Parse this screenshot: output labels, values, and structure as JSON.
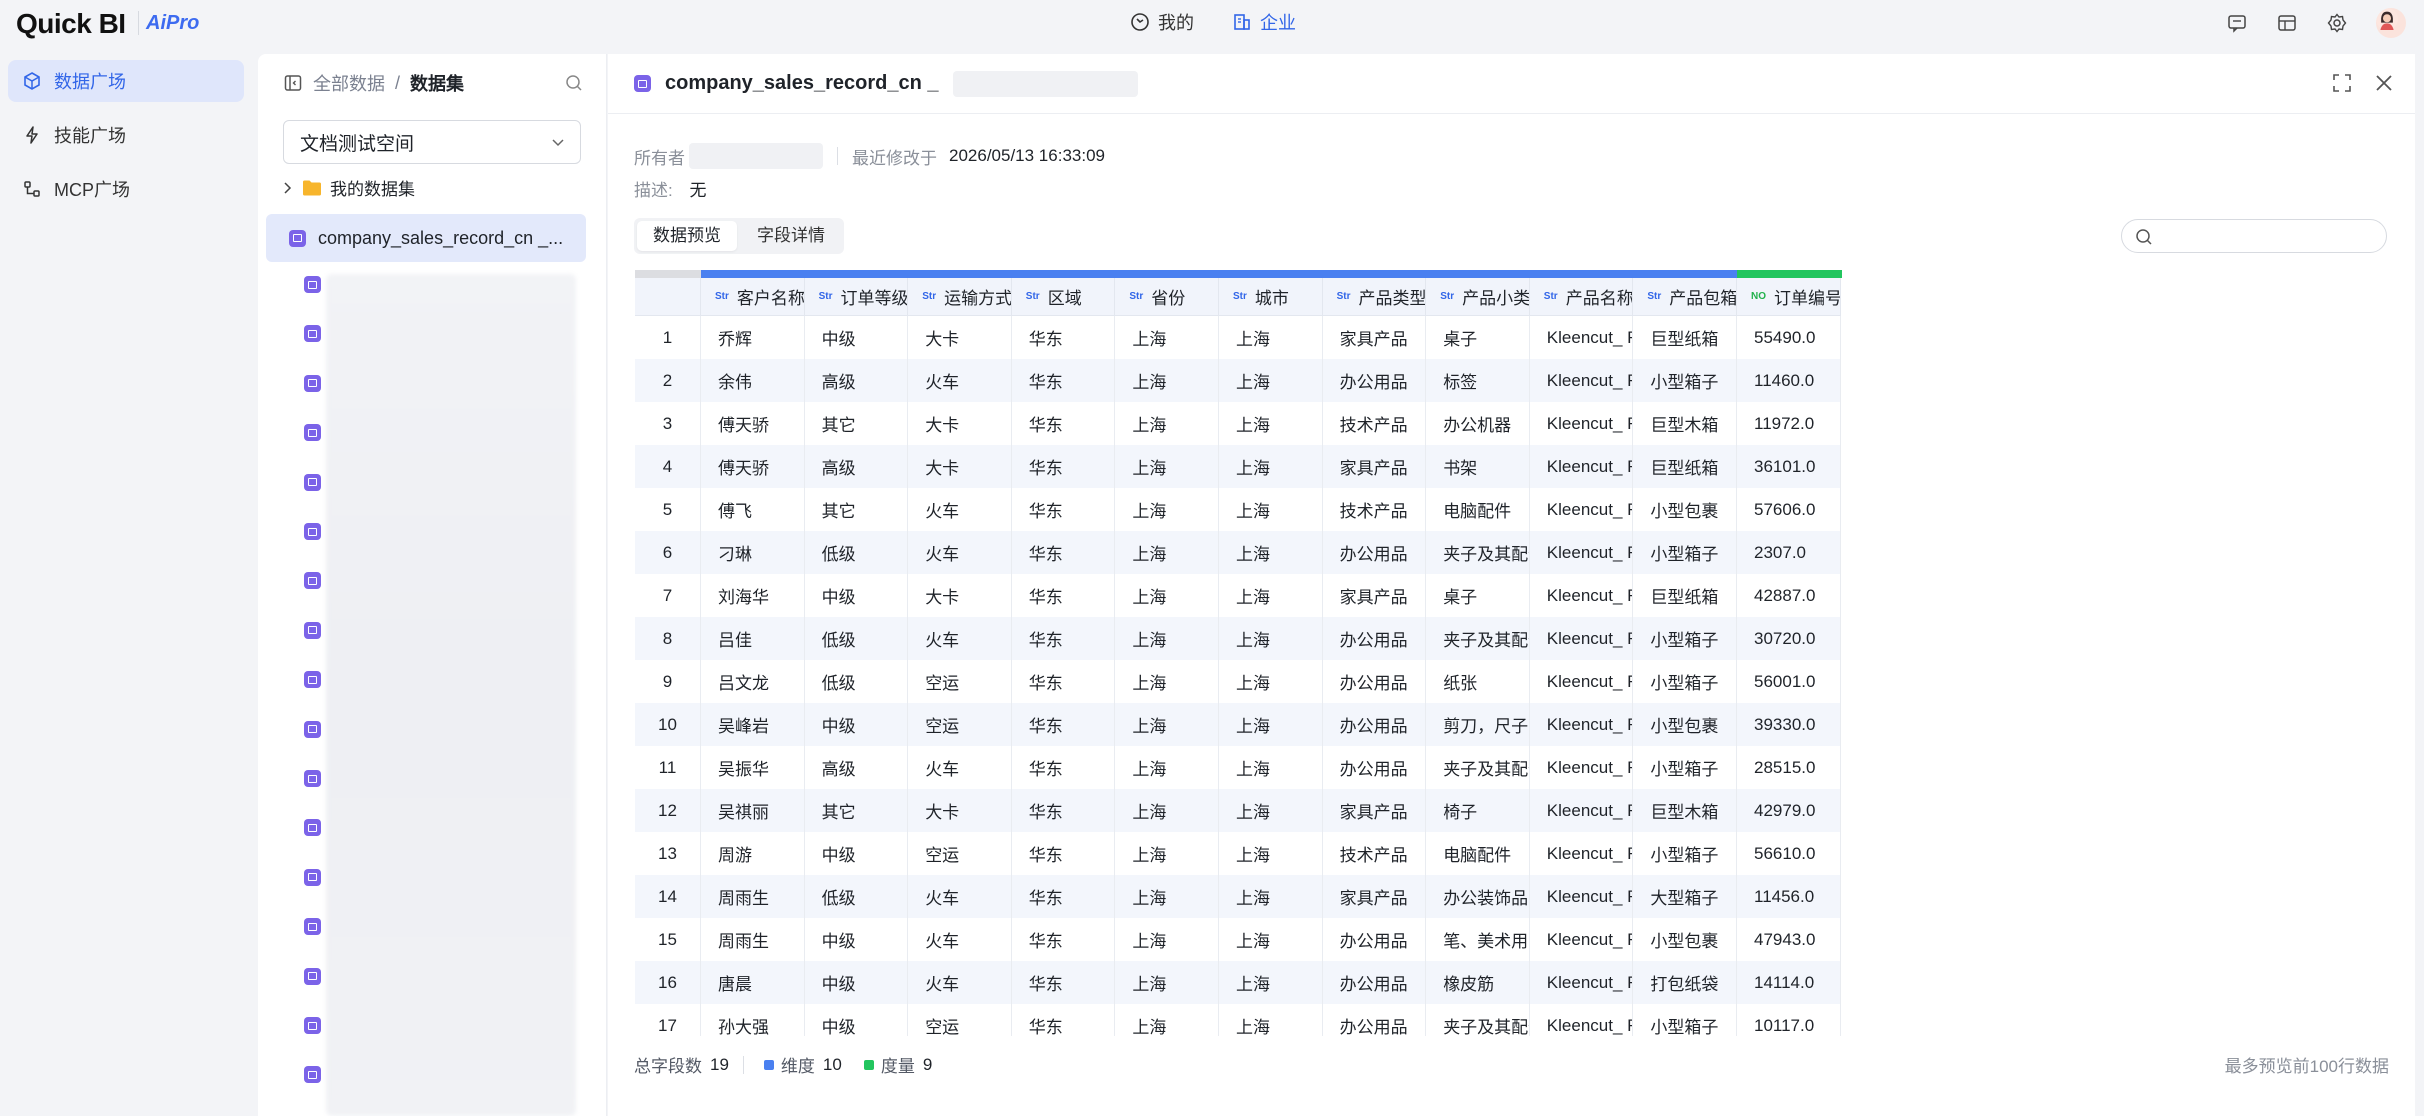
{
  "app": {
    "logo": "Quick BI",
    "badge": "AiPro"
  },
  "top_nav": [
    {
      "label": "我的",
      "icon": "clock-circle-icon",
      "active": false
    },
    {
      "label": "企业",
      "icon": "building-icon",
      "active": true
    }
  ],
  "top_right_icons": [
    "message-icon",
    "layout-icon",
    "gear-icon",
    "user-avatar"
  ],
  "sidebar": {
    "items": [
      {
        "label": "数据广场",
        "icon": "cube-icon",
        "active": true
      },
      {
        "label": "技能广场",
        "icon": "lightning-icon",
        "active": false
      },
      {
        "label": "MCP广场",
        "icon": "plug-icon",
        "active": false
      }
    ]
  },
  "dataset_panel": {
    "breadcrumb_root": "全部数据",
    "breadcrumb_sep": "/",
    "breadcrumb_current": "数据集",
    "space_select": "文档测试空间",
    "folder_label": "我的数据集",
    "active_dataset": "company_sales_record_cn _..."
  },
  "main": {
    "title": "company_sales_record_cn _",
    "owner_label": "所有者",
    "modified_label": "最近修改于",
    "modified_value": "2026/05/13 16:33:09",
    "desc_label": "描述:",
    "desc_value": "无",
    "tabs": [
      "数据预览",
      "字段详情"
    ],
    "columns": [
      {
        "name": "客户名称",
        "type": "Str"
      },
      {
        "name": "订单等级",
        "type": "Str"
      },
      {
        "name": "运输方式",
        "type": "Str"
      },
      {
        "name": "区域",
        "type": "Str"
      },
      {
        "name": "省份",
        "type": "Str"
      },
      {
        "name": "城市",
        "type": "Str"
      },
      {
        "name": "产品类型",
        "type": "Str"
      },
      {
        "name": "产品小类",
        "type": "Str"
      },
      {
        "name": "产品名称",
        "type": "Str"
      },
      {
        "name": "产品包箱",
        "type": "Str"
      },
      {
        "name": "订单编号",
        "type": "NO"
      }
    ],
    "rows": [
      [
        "1",
        "乔辉",
        "中级",
        "大卡",
        "华东",
        "上海",
        "上海",
        "家具产品",
        "桌子",
        "Kleencut_ For...",
        "巨型纸箱",
        "55490.0"
      ],
      [
        "2",
        "余伟",
        "高级",
        "火车",
        "华东",
        "上海",
        "上海",
        "办公用品",
        "标签",
        "Kleencut_ For...",
        "小型箱子",
        "11460.0"
      ],
      [
        "3",
        "傅天骄",
        "其它",
        "大卡",
        "华东",
        "上海",
        "上海",
        "技术产品",
        "办公机器",
        "Kleencut_ For...",
        "巨型木箱",
        "11972.0"
      ],
      [
        "4",
        "傅天骄",
        "高级",
        "大卡",
        "华东",
        "上海",
        "上海",
        "家具产品",
        "书架",
        "Kleencut_ For...",
        "巨型纸箱",
        "36101.0"
      ],
      [
        "5",
        "傅飞",
        "其它",
        "火车",
        "华东",
        "上海",
        "上海",
        "技术产品",
        "电脑配件",
        "Kleencut_ For...",
        "小型包裹",
        "57606.0"
      ],
      [
        "6",
        "刁琳",
        "低级",
        "火车",
        "华东",
        "上海",
        "上海",
        "办公用品",
        "夹子及其配件",
        "Kleencut_ For...",
        "小型箱子",
        "2307.0"
      ],
      [
        "7",
        "刘海华",
        "中级",
        "大卡",
        "华东",
        "上海",
        "上海",
        "家具产品",
        "桌子",
        "Kleencut_ For...",
        "巨型纸箱",
        "42887.0"
      ],
      [
        "8",
        "吕佳",
        "低级",
        "火车",
        "华东",
        "上海",
        "上海",
        "办公用品",
        "夹子及其配件",
        "Kleencut_ For...",
        "小型箱子",
        "30720.0"
      ],
      [
        "9",
        "吕文龙",
        "低级",
        "空运",
        "华东",
        "上海",
        "上海",
        "办公用品",
        "纸张",
        "Kleencut_ For...",
        "小型箱子",
        "56001.0"
      ],
      [
        "10",
        "吴峰岩",
        "中级",
        "空运",
        "华东",
        "上海",
        "上海",
        "办公用品",
        "剪刀，尺子，锯",
        "Kleencut_ For...",
        "小型包裹",
        "39330.0"
      ],
      [
        "11",
        "吴振华",
        "高级",
        "火车",
        "华东",
        "上海",
        "上海",
        "办公用品",
        "夹子及其配件",
        "Kleencut_ For...",
        "小型箱子",
        "28515.0"
      ],
      [
        "12",
        "吴祺丽",
        "其它",
        "大卡",
        "华东",
        "上海",
        "上海",
        "家具产品",
        "椅子",
        "Kleencut_ For...",
        "巨型木箱",
        "42979.0"
      ],
      [
        "13",
        "周游",
        "中级",
        "空运",
        "华东",
        "上海",
        "上海",
        "技术产品",
        "电脑配件",
        "Kleencut_ For...",
        "小型箱子",
        "56610.0"
      ],
      [
        "14",
        "周雨生",
        "低级",
        "火车",
        "华东",
        "上海",
        "上海",
        "家具产品",
        "办公装饰品",
        "Kleencut_ For...",
        "大型箱子",
        "11456.0"
      ],
      [
        "15",
        "周雨生",
        "中级",
        "火车",
        "华东",
        "上海",
        "上海",
        "办公用品",
        "笔、美术用品",
        "Kleencut_ For...",
        "小型包裹",
        "47943.0"
      ],
      [
        "16",
        "唐晨",
        "中级",
        "火车",
        "华东",
        "上海",
        "上海",
        "办公用品",
        "橡皮筋",
        "Kleencut_ For...",
        "打包纸袋",
        "14114.0"
      ],
      [
        "17",
        "孙大强",
        "中级",
        "空运",
        "华东",
        "上海",
        "上海",
        "办公用品",
        "夹子及其配件",
        "Kleencut_ For...",
        "小型箱子",
        "10117.0"
      ]
    ],
    "footer": {
      "total_label": "总字段数",
      "total_value": "19",
      "dim_label": "维度",
      "dim_value": "10",
      "measure_label": "度量",
      "measure_value": "9",
      "note": "最多预览前100行数据"
    }
  },
  "colors": {
    "accent": "#3266e8",
    "dimension": "#4a80f0",
    "measure": "#22c55e",
    "active_bg": "#e3e9fb",
    "dataset_icon": "#7b63e8"
  }
}
